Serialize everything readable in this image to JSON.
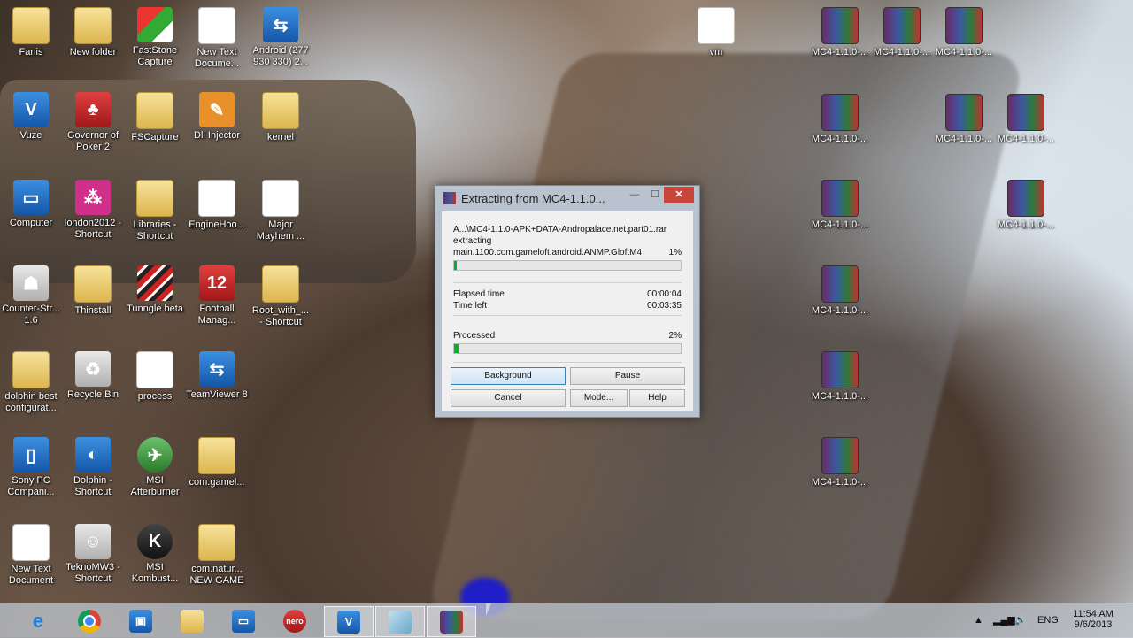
{
  "desktop": {
    "col1": [
      "Fanis",
      "Vuze",
      "Computer",
      "Counter-Str... 1.6",
      "dolphin best configurat...",
      "Sony PC Compani...",
      "New Text Document"
    ],
    "col2": [
      "New folder",
      "Governor of Poker 2",
      "london2012 - Shortcut",
      "Thinstall",
      "Recycle Bin",
      "Dolphin - Shortcut",
      "TeknoMW3 - Shortcut"
    ],
    "col3": [
      "FastStone Capture",
      "FSCapture",
      "Libraries - Shortcut",
      "Tunngle beta",
      "process",
      "MSI Afterburner",
      "MSI Kombust..."
    ],
    "col4": [
      "New Text Docume...",
      "Dll Injector",
      "EngineHoo...",
      "Football Manag...",
      "TeamViewer 8",
      "com.gamel...",
      "com.natur... NEW GAME"
    ],
    "col5": [
      "Android (277 930 330) 2...",
      "kernel",
      "Major Mayhem ...",
      "Root_with_... - Shortcut"
    ],
    "vm": "vm",
    "rar_label": "MC4-1.1.0-..."
  },
  "dialog": {
    "title": "Extracting from MC4-1.1.0...",
    "minimize": "—",
    "maximize": "☐",
    "close": "✕",
    "archive_path": "A...\\MC4-1.1.0-APK+DATA-Andropalace.net.part01.rar",
    "action": "extracting",
    "file": "main.1100.com.gameloft.android.ANMP.GloftM4",
    "file_percent": "1%",
    "file_progress": 0.01,
    "elapsed_label": "Elapsed time",
    "elapsed_value": "00:00:04",
    "left_label": "Time left",
    "left_value": "00:03:35",
    "processed_label": "Processed",
    "processed_percent": "2%",
    "processed_progress": 0.02,
    "buttons": {
      "background": "Background",
      "pause": "Pause",
      "cancel": "Cancel",
      "mode": "Mode...",
      "help": "Help"
    }
  },
  "taskbar": {
    "apps": [
      "internet-explorer",
      "chrome",
      "control-panel",
      "file-explorer",
      "remote-desktop",
      "nero",
      "vuze",
      "fscapture",
      "winrar"
    ],
    "tray": {
      "language": "ENG",
      "time": "11:54 AM",
      "date": "9/6/2013",
      "chevron": "▲"
    }
  }
}
